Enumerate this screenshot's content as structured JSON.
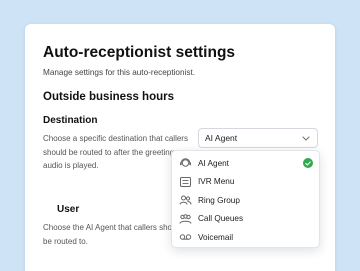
{
  "page": {
    "title": "Auto-receptionist settings",
    "subtitle": "Manage settings for this auto-receptionist.",
    "section_heading": "Outside business hours"
  },
  "destination": {
    "label": "Destination",
    "description": "Choose a specific destination that callers should be routed to after the greeting audio is played.",
    "selected_value": "AI Agent"
  },
  "user": {
    "label": "User",
    "description": "Choose the AI Agent that callers should be routed to."
  },
  "dropdown": {
    "options": [
      {
        "label": "AI Agent",
        "icon": "ai-agent-icon",
        "selected": true
      },
      {
        "label": "IVR Menu",
        "icon": "ivr-menu-icon",
        "selected": false
      },
      {
        "label": "Ring Group",
        "icon": "ring-group-icon",
        "selected": false
      },
      {
        "label": "Call Queues",
        "icon": "call-queues-icon",
        "selected": false
      },
      {
        "label": "Voicemail",
        "icon": "voicemail-icon",
        "selected": false
      }
    ]
  },
  "colors": {
    "background": "#cfe3f6",
    "check_green": "#2faa4f"
  }
}
